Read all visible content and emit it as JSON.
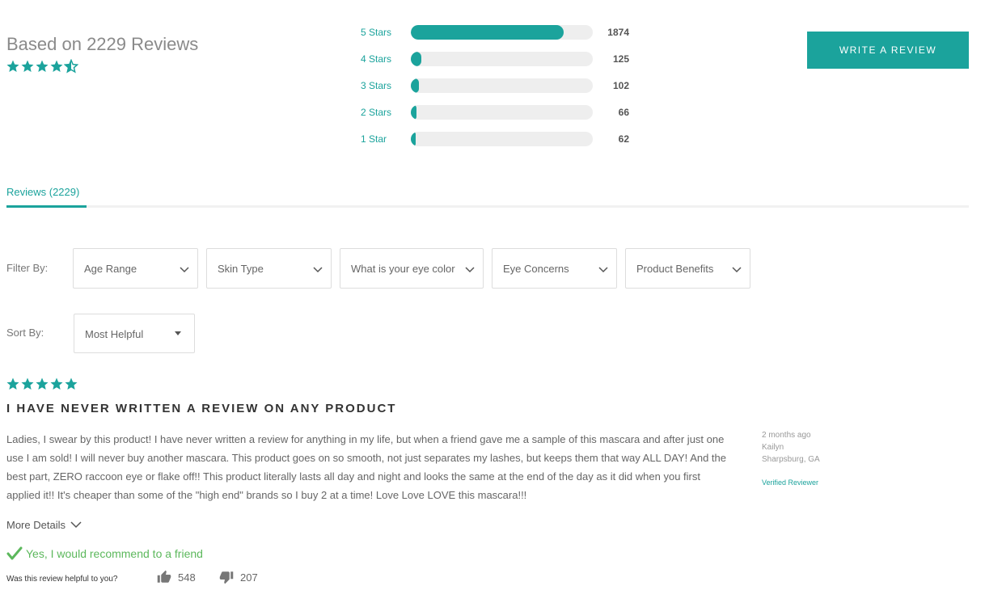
{
  "summary": {
    "based_on": "Based on 2229 Reviews",
    "rating": 4.5
  },
  "histogram": [
    {
      "label": "5 Stars",
      "count": "1874",
      "fraction": 0.84
    },
    {
      "label": "4 Stars",
      "count": "125",
      "fraction": 0.056
    },
    {
      "label": "3 Stars",
      "count": "102",
      "fraction": 0.046
    },
    {
      "label": "2 Stars",
      "count": "66",
      "fraction": 0.03
    },
    {
      "label": "1 Star",
      "count": "62",
      "fraction": 0.028
    }
  ],
  "write_review_label": "WRITE A REVIEW",
  "tabs": {
    "reviews": "Reviews (2229)"
  },
  "filters": {
    "label": "Filter By:",
    "items": [
      "Age Range",
      "Skin Type",
      "What is your eye color",
      "Eye Concerns",
      "Product Benefits"
    ]
  },
  "sort": {
    "label": "Sort By:",
    "selected": "Most Helpful"
  },
  "review": {
    "rating": 5,
    "title": "I HAVE NEVER WRITTEN A REVIEW ON ANY PRODUCT",
    "body": "Ladies, I swear by this product! I have never written a review for anything in my life, but when a friend gave me a sample of this mascara and after just one use I am sold! I will never buy another mascara. This product goes on so smooth, not just separates my lashes, but keeps them that way ALL DAY! And the best part, ZERO raccoon eye or flake off!! This product literally lasts all day and night and looks the same at the end of the day as it did when you first applied it!! It's cheaper than some of the \"high end\" brands so I buy 2 at a time! Love Love LOVE this mascara!!!",
    "date": "2 months ago",
    "author": "Kailyn",
    "location": "Sharpsburg, GA",
    "verified": "Verified Reviewer",
    "more_details": "More Details",
    "recommend": "Yes, I would recommend to a friend",
    "helpful_question": "Was this review helpful to you?",
    "helpful_yes": "548",
    "helpful_no": "207"
  },
  "colors": {
    "accent": "#1ba39c",
    "recommend": "#5cb85c"
  },
  "icons": [
    "star-icon",
    "half-star-icon",
    "chevron-down-icon",
    "caret-down-icon",
    "checkmark-icon",
    "thumbs-up-icon",
    "thumbs-down-icon"
  ]
}
